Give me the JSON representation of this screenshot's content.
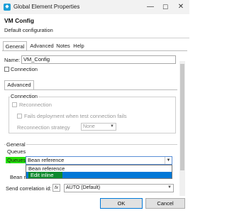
{
  "window": {
    "title": "Global Element Properties",
    "icon_name": "app-icon",
    "controls": [
      "minimize-icon",
      "maximize-icon",
      "close-icon"
    ]
  },
  "header": {
    "title": "VM Config",
    "description": "Default configuration"
  },
  "tabs": [
    {
      "label": "General",
      "active": true
    },
    {
      "label": "Advanced",
      "active": false
    },
    {
      "label": "Notes",
      "active": false
    },
    {
      "label": "Help",
      "active": false
    }
  ],
  "name_field": {
    "label": "Name:",
    "value": "VM_Config"
  },
  "connection_checkbox": {
    "label": "Connection",
    "checked": false
  },
  "inner_tab": {
    "label": "Advanced"
  },
  "connection_group": {
    "title": "Connection",
    "reconnection_label": "Reconnection",
    "fails_deployment_label": "Fails deployment when test connection fails",
    "strategy_label": "Reconnection strategy",
    "strategy_value": "None"
  },
  "general_group": {
    "title": "General",
    "queues_heading": "Queues",
    "queues_label": "Queues",
    "queues_value": "Bean reference",
    "dropdown_options": [
      "Bean reference",
      "Edit inline"
    ],
    "selected_option_index": 1,
    "bean_label_partial": "Bean r",
    "send_correlation_label": "Send correlation id:",
    "send_correlation_value": "AUTO (Default)"
  },
  "buttons": {
    "ok": "OK",
    "cancel": "Cancel"
  },
  "colors": {
    "highlight_green": "#22e000",
    "highlight_dark_green": "#0c8a2e",
    "selection_blue": "#0078d7"
  }
}
